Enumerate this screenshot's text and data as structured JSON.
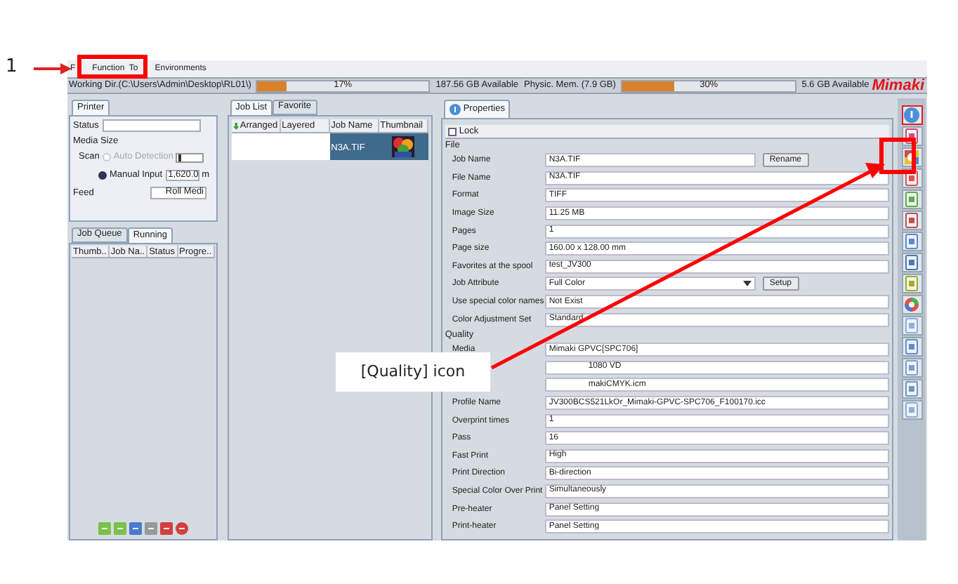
{
  "annotations": {
    "step_number": "1",
    "callout": "[Quality] icon"
  },
  "menu": [
    {
      "label": "F"
    },
    {
      "label": "Function  To"
    },
    {
      "label": "Environments"
    }
  ],
  "status_bar": {
    "working_dir": "Working Dir.(C:\\Users\\Admin\\Desktop\\RL01\\)",
    "disk": {
      "level": 0.17,
      "reading": "17%",
      "available": "187.56 GB Available"
    },
    "memory": {
      "label": "Physic. Mem. (7.9 GB)",
      "level": 0.3,
      "reading": "30%",
      "available": "5.6 GB Available"
    },
    "logo": "Mimaki"
  },
  "printer_panel": {
    "tabs": [
      {
        "label": "Printer",
        "selected": true
      }
    ],
    "status_label": "Status",
    "media_size": "Media Size",
    "scan": "Scan",
    "scan_slider": {
      "level": 0.05
    },
    "auto_detection": {
      "label": "Auto Detection",
      "selected": false,
      "disabled": true
    },
    "manual_input": {
      "label": "Manual Input",
      "selected": true
    },
    "manual_value": "1,620.0",
    "unit": "m",
    "feed": "Feed",
    "feed_value": "Roll Medi"
  },
  "queue_panel": {
    "tabs": [
      {
        "label": "Job Queue",
        "selected": false
      },
      {
        "label": "Running",
        "selected": true
      }
    ],
    "columns": [
      "Thumb..",
      "Job Na..",
      "Status",
      "Progre.."
    ]
  },
  "job_list": {
    "tabs": [
      {
        "label": "Job List",
        "selected": true
      },
      {
        "label": "Favorite",
        "selected": false
      }
    ],
    "columns": [
      "Arranged",
      "Layered",
      "Job Name",
      "Thumbnail"
    ],
    "rows": [
      {
        "job_name": "N3A.TIF",
        "selected": true
      }
    ]
  },
  "properties": {
    "tab": "Properties",
    "lock": {
      "label": "Lock",
      "checked": false
    },
    "sections": [
      {
        "title": "File",
        "rows": [
          {
            "label": "Job Name",
            "value": "N3A.TIF",
            "kind": "button",
            "button": "Rename"
          },
          {
            "label": "File Name",
            "value": "N3A.TIF",
            "kind": "text"
          },
          {
            "label": "Format",
            "value": "TIFF",
            "kind": "text"
          },
          {
            "label": "Image Size",
            "value": "11.25 MB",
            "kind": "text"
          },
          {
            "label": "Pages",
            "value": "1",
            "kind": "text"
          },
          {
            "label": "Page size",
            "value": "160.00 x 128.00 mm",
            "kind": "text"
          },
          {
            "label": "Favorites at the spool",
            "value": "test_JV300",
            "kind": "text"
          },
          {
            "label": "Job Attribute",
            "value": "Full Color",
            "kind": "select",
            "button": "Setup"
          },
          {
            "label": "Use special color names",
            "value": "Not Exist",
            "kind": "text"
          },
          {
            "label": "Color Adjustment Set",
            "value": "Standard",
            "kind": "text"
          }
        ]
      },
      {
        "title": "Quality",
        "rows": [
          {
            "label": "Media",
            "value": "Mimaki GPVC[SPC706]",
            "kind": "text"
          },
          {
            "value": "1080 VD",
            "kind": "covered"
          },
          {
            "value": "makiCMYK.icm",
            "kind": "covered"
          },
          {
            "label": "Profile Name",
            "value": "JV300BCS521LkOr_Mimaki-GPVC-SPC706_F100170.icc",
            "kind": "text"
          },
          {
            "label": "Overprint times",
            "value": "1",
            "kind": "text"
          },
          {
            "label": "Pass",
            "value": "16",
            "kind": "text"
          },
          {
            "label": "Fast Print",
            "value": "High",
            "kind": "text"
          },
          {
            "label": "Print Direction",
            "value": "Bi-direction",
            "kind": "text"
          },
          {
            "label": "Special Color Over Print",
            "value": "Simultaneously",
            "kind": "text"
          },
          {
            "label": "Pre-heater",
            "value": "Panel Setting",
            "kind": "text"
          },
          {
            "label": "Print-heater",
            "value": "Panel Setting",
            "kind": "text"
          }
        ]
      }
    ]
  },
  "side_toolbar": [
    {
      "selected": true
    },
    {
      "selected": false
    },
    {
      "selected": false
    },
    {
      "selected": false
    },
    {
      "selected": false
    },
    {
      "selected": false
    },
    {
      "selected": false
    },
    {
      "selected": false
    },
    {
      "selected": false
    },
    {
      "selected": false
    },
    {
      "selected": false
    },
    {
      "selected": false
    },
    {
      "selected": false
    },
    {
      "selected": false
    },
    {
      "selected": false
    }
  ]
}
